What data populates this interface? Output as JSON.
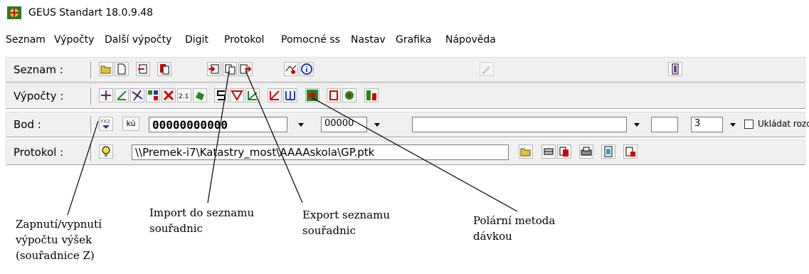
{
  "window": {
    "title": "GEUS Standart 18.0.9.48"
  },
  "menu": [
    "Seznam",
    "Výpočty",
    "Další výpočty",
    "Digit",
    "Protokol",
    "Pomocné ss",
    "Nastav",
    "Grafika",
    "Nápověda"
  ],
  "rows": {
    "seznam": {
      "label": "Seznam :"
    },
    "vypocty": {
      "label": "Výpočty :"
    },
    "bod": {
      "label": "Bod :",
      "yxz_label": "YX2",
      "ku_button": "kú",
      "point_number": "00000000000",
      "code_value": "00000",
      "count_value": "3",
      "checkbox_label": "Ukládat rozdíly YX"
    },
    "protokol": {
      "label": "Protokol :",
      "path_value": "\\\\Premek-i7\\Katastry_most\\AAAAskola\\GP.ptk"
    }
  },
  "annotations": {
    "height_toggle": [
      "Zapnutí/vypnutí",
      "výpočtu výšek",
      "(souřadnice Z)"
    ],
    "import": [
      "Import do seznamu",
      "souřadnic"
    ],
    "export": [
      "Export seznamu",
      "souřadnic"
    ],
    "polar": [
      "Polární metoda",
      "dávkou"
    ]
  },
  "colors": {
    "panel_bg": "#f0f0f0",
    "accent_red": "#d40000",
    "accent_blue": "#1e3cb4",
    "accent_green": "#1a8a1a"
  }
}
